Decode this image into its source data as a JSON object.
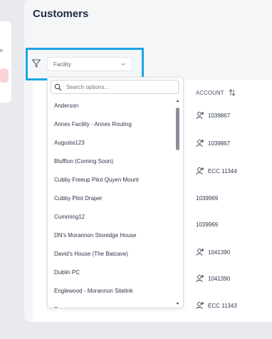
{
  "page": {
    "title": "Customers"
  },
  "filter": {
    "icon": "filter-icon",
    "selected_value": "Facility",
    "highlight_color": "#1ca5e5"
  },
  "dropdown": {
    "search_placeholder": "Search options...",
    "options": [
      "Anderson",
      "Annex Facility - Annex Routing",
      "Augusta123",
      "Bluffton (Coming Soon)",
      "Cubby Freeup Pilot Quyen Mount",
      "Cubby Pilot Draper",
      "Cumming12",
      "DN's Morannon Storedge House",
      "David's House (The Batcave)",
      "Dublin PC",
      "Englewood - Morannon Sitelink",
      "Eunon"
    ]
  },
  "table": {
    "column_header": "ACCOUNT",
    "rows": [
      {
        "account": "1039867",
        "icon": "add-user-icon"
      },
      {
        "account": "1039867",
        "icon": "add-user-icon"
      },
      {
        "account": "ECC 11344",
        "icon": "add-user-icon"
      },
      {
        "account": "1039969",
        "icon": ""
      },
      {
        "account": "1039969",
        "icon": ""
      },
      {
        "account": "1041390",
        "icon": "add-user-icon"
      },
      {
        "account": "1041390",
        "icon": "add-user-icon"
      },
      {
        "account": "ECC 11343",
        "icon": "add-user-icon"
      }
    ]
  }
}
